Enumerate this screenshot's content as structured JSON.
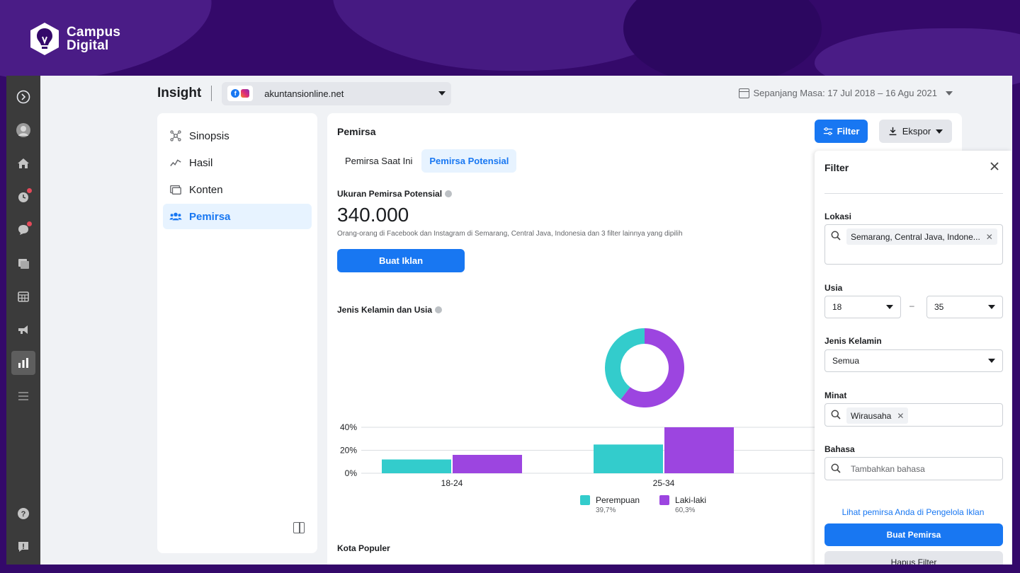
{
  "brand": {
    "line1": "Campus",
    "line2": "Digital"
  },
  "topbar": {
    "title": "Insight",
    "account": "akuntansionline.net",
    "date_range": "Sepanjang Masa: 17 Jul 2018 – 16 Agu 2021"
  },
  "rail": {
    "items": [
      "logo-icon",
      "avatar",
      "home-icon",
      "clock-icon",
      "chat-icon",
      "pages-icon",
      "calendar-icon",
      "megaphone-icon",
      "insights-icon",
      "menu-icon"
    ],
    "bottom": [
      "help-icon",
      "report-icon"
    ]
  },
  "nav": {
    "items": [
      {
        "label": "Sinopsis",
        "icon": "overview-icon"
      },
      {
        "label": "Hasil",
        "icon": "results-icon"
      },
      {
        "label": "Konten",
        "icon": "content-icon"
      },
      {
        "label": "Pemirsa",
        "icon": "audience-icon",
        "active": true
      }
    ]
  },
  "main": {
    "title": "Pemirsa",
    "filter_label": "Filter",
    "export_label": "Ekspor",
    "tabs": [
      "Pemirsa Saat Ini",
      "Pemirsa Potensial"
    ],
    "audience_size_label": "Ukuran Pemirsa Potensial",
    "audience_size": "340.000",
    "audience_desc": "Orang-orang di Facebook dan Instagram di Semarang, Central Java, Indonesia dan 3 filter lainnya yang dipilih",
    "create_ad_label": "Buat Iklan",
    "gender_age_label": "Jenis Kelamin dan Usia",
    "top_cities_label": "Kota Populer"
  },
  "chart_data": {
    "type": "bar",
    "categories": [
      "18-24",
      "25-34"
    ],
    "series": [
      {
        "name": "Perempuan",
        "values": [
          12,
          25
        ],
        "color": "#33cccc"
      },
      {
        "name": "Laki-laki",
        "values": [
          16,
          40
        ],
        "color": "#9c45e0"
      }
    ],
    "ylim": [
      0,
      40
    ],
    "yticks": [
      "40%",
      "20%",
      "0%"
    ],
    "donut": {
      "Perempuan": 39.7,
      "Laki-laki": 60.3
    },
    "legend": [
      {
        "name": "Perempuan",
        "value": "39,7%",
        "color": "#33cccc"
      },
      {
        "name": "Laki-laki",
        "value": "60,3%",
        "color": "#9c45e0"
      }
    ]
  },
  "filter": {
    "title": "Filter",
    "location_label": "Lokasi",
    "location_chip": "Semarang, Central Java, Indone...",
    "age_label": "Usia",
    "age_min": "18",
    "age_dash": "–",
    "age_max": "35",
    "gender_label": "Jenis Kelamin",
    "gender_value": "Semua",
    "interest_label": "Minat",
    "interest_chip": "Wirausaha",
    "language_label": "Bahasa",
    "language_placeholder": "Tambahkan bahasa",
    "ads_manager_link": "Lihat pemirsa Anda di Pengelola Iklan",
    "create_audience": "Buat Pemirsa",
    "clear_filter": "Hapus Filter"
  }
}
